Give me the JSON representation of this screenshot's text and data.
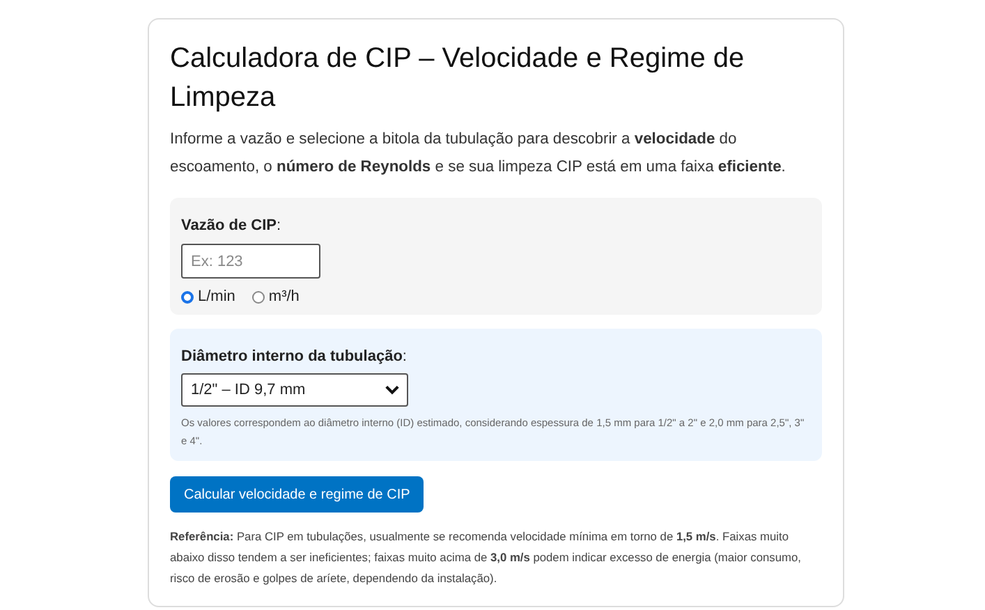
{
  "title": "Calculadora de CIP – Velocidade e Regime de Limpeza",
  "intro": "Informe a vazão e selecione a bitola da tubulação para descobrir a **velocidade** do escoamento, o **número de Reynolds** e se sua limpeza CIP está em uma faixa **eficiente**.",
  "flow": {
    "label": "**Vazão de CIP**:",
    "placeholder": "Ex: 123",
    "units": [
      {
        "label": "L/min",
        "selected": true
      },
      {
        "label": "m³/h",
        "selected": false
      }
    ]
  },
  "diameter": {
    "label": "**Diâmetro interno da tubulação**:",
    "value": "1/2\" – ID 9,7 mm",
    "note": "Os valores correspondem ao diâmetro interno (ID) estimado, considerando espessura de 1,5 mm para 1/2\" a 2\" e 2,0 mm para 2,5\", 3\" e 4\"."
  },
  "button": "Calcular velocidade e regime de CIP",
  "reference": "**Referência:** Para CIP em tubulações, usualmente se recomenda velocidade mínima em torno de **1,5 m/s**. Faixas muito abaixo disso tendem a ser ineficientes; faixas muito acima de **3,0 m/s** podem indicar excesso de energia (maior consumo, risco de erosão e golpes de aríete, dependendo da instalação)."
}
